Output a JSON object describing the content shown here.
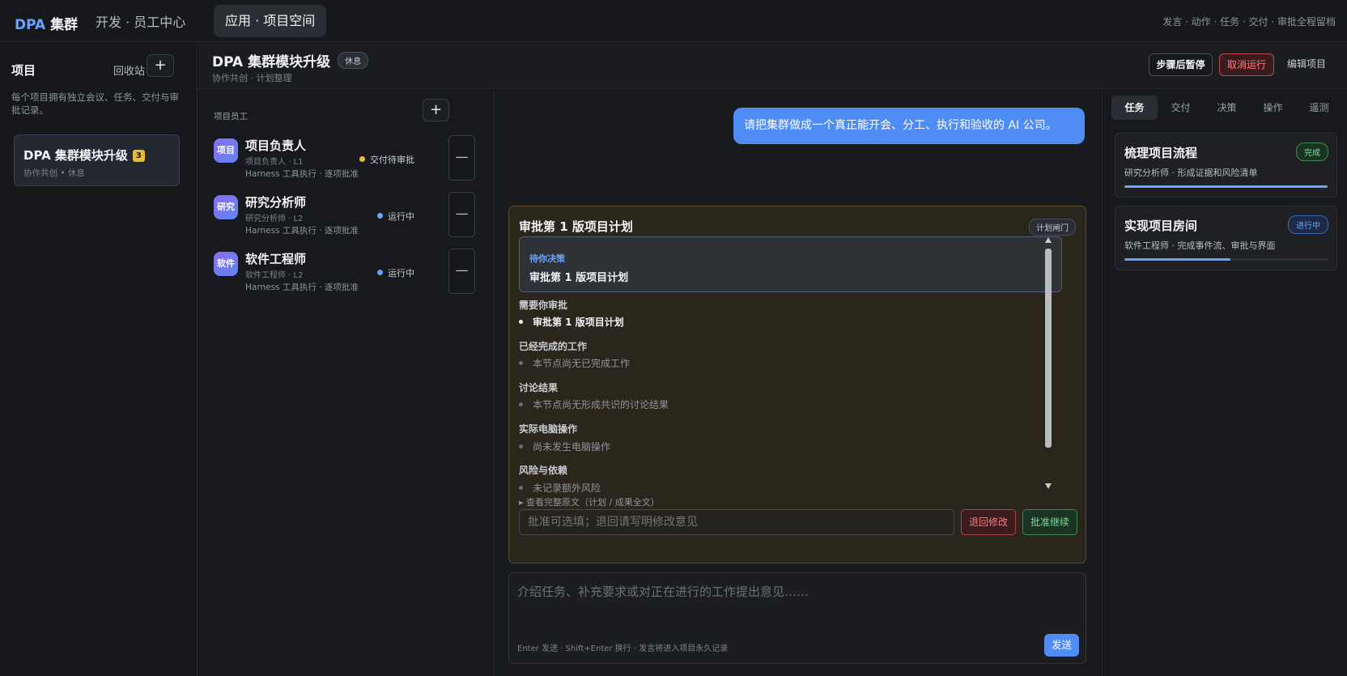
{
  "topbar": {
    "logo_brand": "DPA",
    "logo_rest": " 集群",
    "nav_dev": "开发 · 员工中心",
    "nav_app": "应用 · 项目空间",
    "links": "发言 · 动作 · 任务 · 交付 · 审批全程留档"
  },
  "sidebar": {
    "title": "项目",
    "recycle": "回收站",
    "add": "+",
    "description": "每个项目拥有独立会议、任务、交付与审批记录。",
    "project": {
      "name": "DPA 集群模块升级",
      "badge": "3",
      "sub": "协作共创 • 休息"
    }
  },
  "header": {
    "title": "DPA 集群模块升级",
    "status": "休息",
    "sub": "协作共创 · 计划整理",
    "pause": "步骤后暂停",
    "cancel": "取消运行",
    "edit": "编辑项目"
  },
  "members": {
    "label": "项目员工",
    "add": "+",
    "list": [
      {
        "avatar": "项目",
        "name": "项目负责人",
        "role": "项目负责人 · L1",
        "tool": "Harness 工具执行 · 逐项批准",
        "status": "交付待审批",
        "status_color": "#e8b93a",
        "action": "—"
      },
      {
        "avatar": "研究",
        "name": "研究分析师",
        "role": "研究分析师 · L2",
        "tool": "Harness 工具执行 · 逐项批准",
        "status": "运行中",
        "status_color": "#6aa3ff",
        "action": "—"
      },
      {
        "avatar": "软件",
        "name": "软件工程师",
        "role": "软件工程师 · L2",
        "tool": "Harness 工具执行 · 逐项批准",
        "status": "运行中",
        "status_color": "#6aa3ff",
        "action": "—"
      }
    ]
  },
  "chat": {
    "user_message": "请把集群做成一个真正能开会、分工、执行和验收的 AI 公司。",
    "gate": {
      "title": "审批第 1 版项目计划",
      "tag": "计划闸门",
      "pending_label": "待你决策",
      "pending_value": "审批第 1 版项目计划",
      "sections": [
        {
          "title": "需要你审批",
          "item": "审批第 1 版项目计划"
        },
        {
          "title": "已经完成的工作",
          "item": "本节点尚无已完成工作"
        },
        {
          "title": "讨论结果",
          "item": "本节点尚无形成共识的讨论结果"
        },
        {
          "title": "实际电脑操作",
          "item": "尚未发生电脑操作"
        },
        {
          "title": "风险与依赖",
          "item": "未记录额外风险"
        }
      ],
      "full_text": "▸ 查看完整原文（计划 / 成果全文）",
      "input_placeholder": "批准可选填；退回请写明修改意见",
      "return": "退回修改",
      "approve": "批准继续"
    },
    "composer": {
      "placeholder": "介绍任务、补充要求或对正在进行的工作提出意见……",
      "hint": "Enter 发送 · Shift+Enter 换行 · 发言将进入项目永久记录",
      "send": "发送"
    }
  },
  "right": {
    "tabs": [
      "任务",
      "交付",
      "决策",
      "操作",
      "遥测"
    ],
    "tasks": [
      {
        "title": "梳理项目流程",
        "sub": "研究分析师 · 形成证据和风险清单",
        "status": "完成",
        "progress": 1.0
      },
      {
        "title": "实现项目房间",
        "sub": "软件工程师 · 完成事件流、审批与界面",
        "status": "进行中",
        "progress": 0.52
      }
    ]
  }
}
